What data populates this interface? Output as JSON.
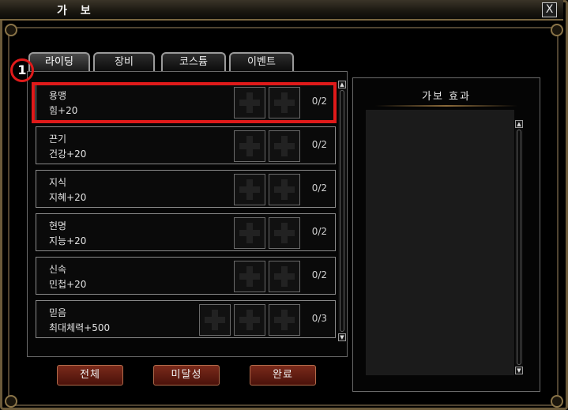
{
  "window": {
    "title": "가 보",
    "close_label": "X"
  },
  "tabs": [
    {
      "label": "라이딩",
      "active": true
    },
    {
      "label": "장비",
      "active": false
    },
    {
      "label": "코스튬",
      "active": false
    },
    {
      "label": "이벤트",
      "active": false
    }
  ],
  "marker_label": "1",
  "items": [
    {
      "name": "용맹",
      "stat": "힘+20",
      "count": "0/2",
      "slots": 2
    },
    {
      "name": "끈기",
      "stat": "건강+20",
      "count": "0/2",
      "slots": 2
    },
    {
      "name": "지식",
      "stat": "지혜+20",
      "count": "0/2",
      "slots": 2
    },
    {
      "name": "현명",
      "stat": "지능+20",
      "count": "0/2",
      "slots": 2
    },
    {
      "name": "신속",
      "stat": "민첩+20",
      "count": "0/2",
      "slots": 2
    },
    {
      "name": "믿음",
      "stat": "최대체력+500",
      "count": "0/3",
      "slots": 3
    }
  ],
  "effect_panel": {
    "title": "가보 효과"
  },
  "buttons": {
    "all": "전체",
    "incomplete": "미달성",
    "complete": "완료"
  },
  "colors": {
    "highlight": "#e01a1a",
    "button": "#6a1e12",
    "frame": "#6b5a3a"
  },
  "icons": {
    "slot": "plus-icon",
    "close": "close-icon"
  }
}
